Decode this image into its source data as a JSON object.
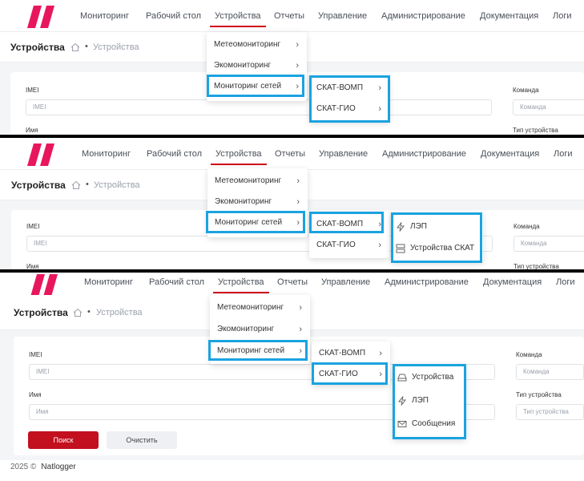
{
  "nav": {
    "items": [
      "Мониторинг",
      "Рабочий стол",
      "Устройства",
      "Отчеты",
      "Управление",
      "Администрирование",
      "Документация",
      "Логи"
    ],
    "active_index": 2
  },
  "page": {
    "title": "Устройства",
    "breadcrumb_dot": "•",
    "breadcrumb_current": "Устройства"
  },
  "menu": {
    "level1": [
      "Метеомониторинг",
      "Экомониторинг",
      "Мониторинг сетей"
    ],
    "level2": [
      "СКАТ-ВОМП",
      "СКАТ-ГИО"
    ],
    "vomp_items": [
      "ЛЭП",
      "Устройства СКАТ"
    ],
    "gio_items": [
      "Устройства",
      "ЛЭП",
      "Сообщения"
    ],
    "chevron": "›"
  },
  "form": {
    "imei_label": "IMEI",
    "imei_placeholder": "IMEI",
    "name_label": "Имя",
    "name_placeholder": "Имя",
    "command_label": "Команда",
    "command_placeholder": "Команда",
    "device_type_label": "Тип устройства",
    "device_type_placeholder": "Тип устройства",
    "search_button": "Поиск",
    "clear_button": "Очистить"
  },
  "footer": {
    "year": "2025 ©",
    "brand": "Natlogger"
  },
  "colors": {
    "accent": "#d0021b",
    "highlight": "#1aa3e0",
    "logo": "#e8175d"
  }
}
